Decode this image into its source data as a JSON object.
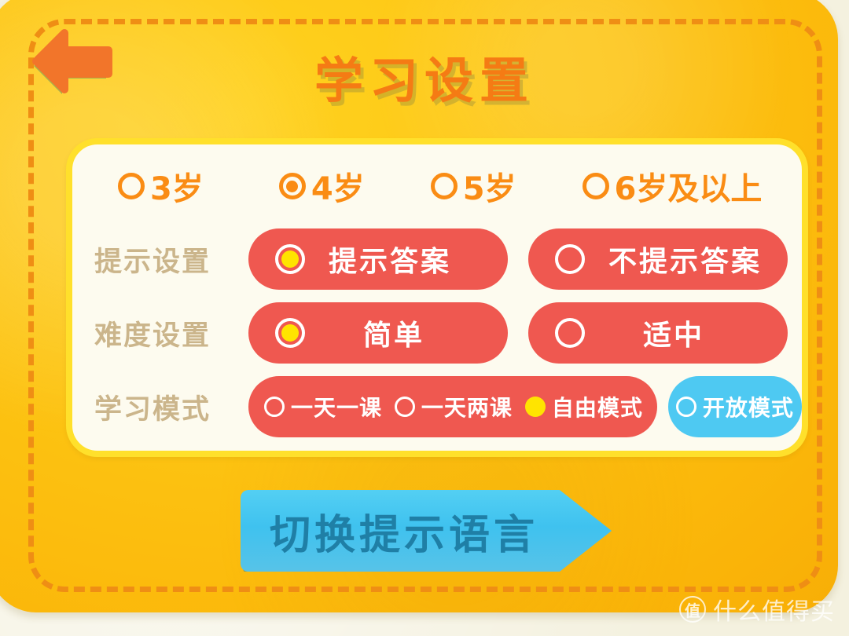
{
  "app": {
    "title": "学习设置",
    "back_icon": "back-arrow-icon"
  },
  "colors": {
    "panel_yellow": "#fdc513",
    "dashed_border": "#ef8e14",
    "title_orange": "#f57b14",
    "card_bg": "#fdfbef",
    "card_border": "#ffe02b",
    "label_tan": "#cbb58b",
    "pill_red": "#ef5850",
    "pill_blue": "#4ec9f2",
    "radio_selected_yellow": "#ffe400",
    "lang_button_blue": "#3fc2ef",
    "lang_button_text": "#1f7fa6"
  },
  "age_group": {
    "options": [
      {
        "label": "3岁",
        "selected": false
      },
      {
        "label": "4岁",
        "selected": true
      },
      {
        "label": "5岁",
        "selected": false
      },
      {
        "label": "6岁及以上",
        "selected": false
      }
    ]
  },
  "rows": {
    "hint": {
      "label": "提示设置",
      "options": [
        {
          "label": "提示答案",
          "selected": true
        },
        {
          "label": "不提示答案",
          "selected": false
        }
      ]
    },
    "difficulty": {
      "label": "难度设置",
      "options": [
        {
          "label": "简单",
          "selected": true
        },
        {
          "label": "适中",
          "selected": false
        }
      ]
    },
    "mode": {
      "label": "学习模式",
      "options": [
        {
          "label": "一天一课",
          "selected": false
        },
        {
          "label": "一天两课",
          "selected": false
        },
        {
          "label": "自由模式",
          "selected": true
        }
      ],
      "open_option": {
        "label": "开放模式",
        "selected": false
      }
    }
  },
  "bottom_button": {
    "label": "切换提示语言"
  },
  "watermark": {
    "logo": "值",
    "text": "什么值得买"
  }
}
